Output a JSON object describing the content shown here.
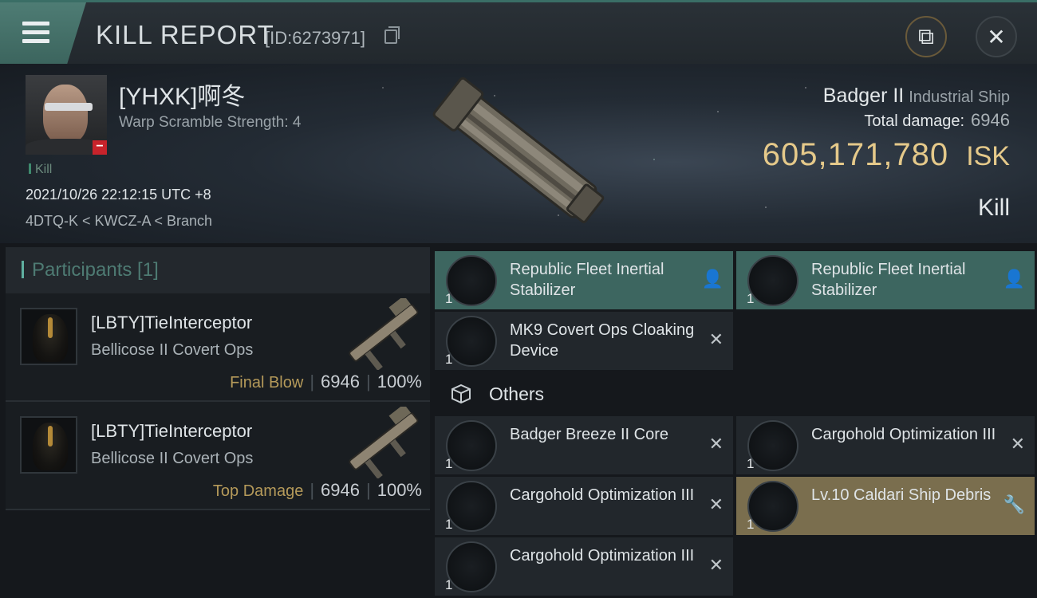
{
  "header": {
    "title": "KILL REPORT",
    "report_id": "[ID:6273971]"
  },
  "victim": {
    "name": "[YHXK]啊冬",
    "scramble": "Warp Scramble Strength: 4",
    "tag": "Kill",
    "date": "2021/10/26 22:12:15 UTC +8",
    "location": "4DTQ-K < KWCZ-A < Branch",
    "ship_name": "Badger II",
    "ship_class": "Industrial Ship",
    "damage_label": "Total damage:",
    "damage_value": "6946",
    "isk_value": "605,171,780",
    "isk_unit": "ISK",
    "result": "Kill"
  },
  "participants": {
    "title": "Participants [1]",
    "rows": [
      {
        "name": "[LBTY]TieInterceptor",
        "ship": "Bellicose II Covert Ops",
        "role": "Final Blow",
        "damage": "6946",
        "percent": "100%"
      },
      {
        "name": "[LBTY]TieInterceptor",
        "ship": "Bellicose II Covert Ops",
        "role": "Top Damage",
        "damage": "6946",
        "percent": "100%"
      }
    ]
  },
  "modules": [
    {
      "name": "Republic Fleet Inertial Stabilizer",
      "qty": "1",
      "state": "fitted",
      "icon": "stabilizer-icon"
    },
    {
      "name": "Republic Fleet Inertial Stabilizer",
      "qty": "1",
      "state": "fitted",
      "icon": "stabilizer-icon"
    },
    {
      "name": "MK9 Covert Ops Cloaking Device",
      "qty": "1",
      "state": "destroyed",
      "icon": "cloak-icon"
    }
  ],
  "others": {
    "label": "Others",
    "items": [
      {
        "name": "Badger Breeze II Core",
        "qty": "1",
        "state": "destroyed",
        "icon": "core-icon"
      },
      {
        "name": "Cargohold Optimization III",
        "qty": "1",
        "state": "destroyed",
        "icon": "rig-icon"
      },
      {
        "name": "Cargohold Optimization III",
        "qty": "1",
        "state": "destroyed",
        "icon": "rig-icon"
      },
      {
        "name": "Lv.10 Caldari Ship Debris",
        "qty": "1",
        "state": "debris",
        "icon": "debris-icon"
      },
      {
        "name": "Cargohold Optimization III",
        "qty": "1",
        "state": "destroyed",
        "icon": "rig-icon"
      }
    ]
  },
  "colors": {
    "accent": "#3d6660",
    "gold": "#e5c98a",
    "debris": "#7a6e4e"
  }
}
